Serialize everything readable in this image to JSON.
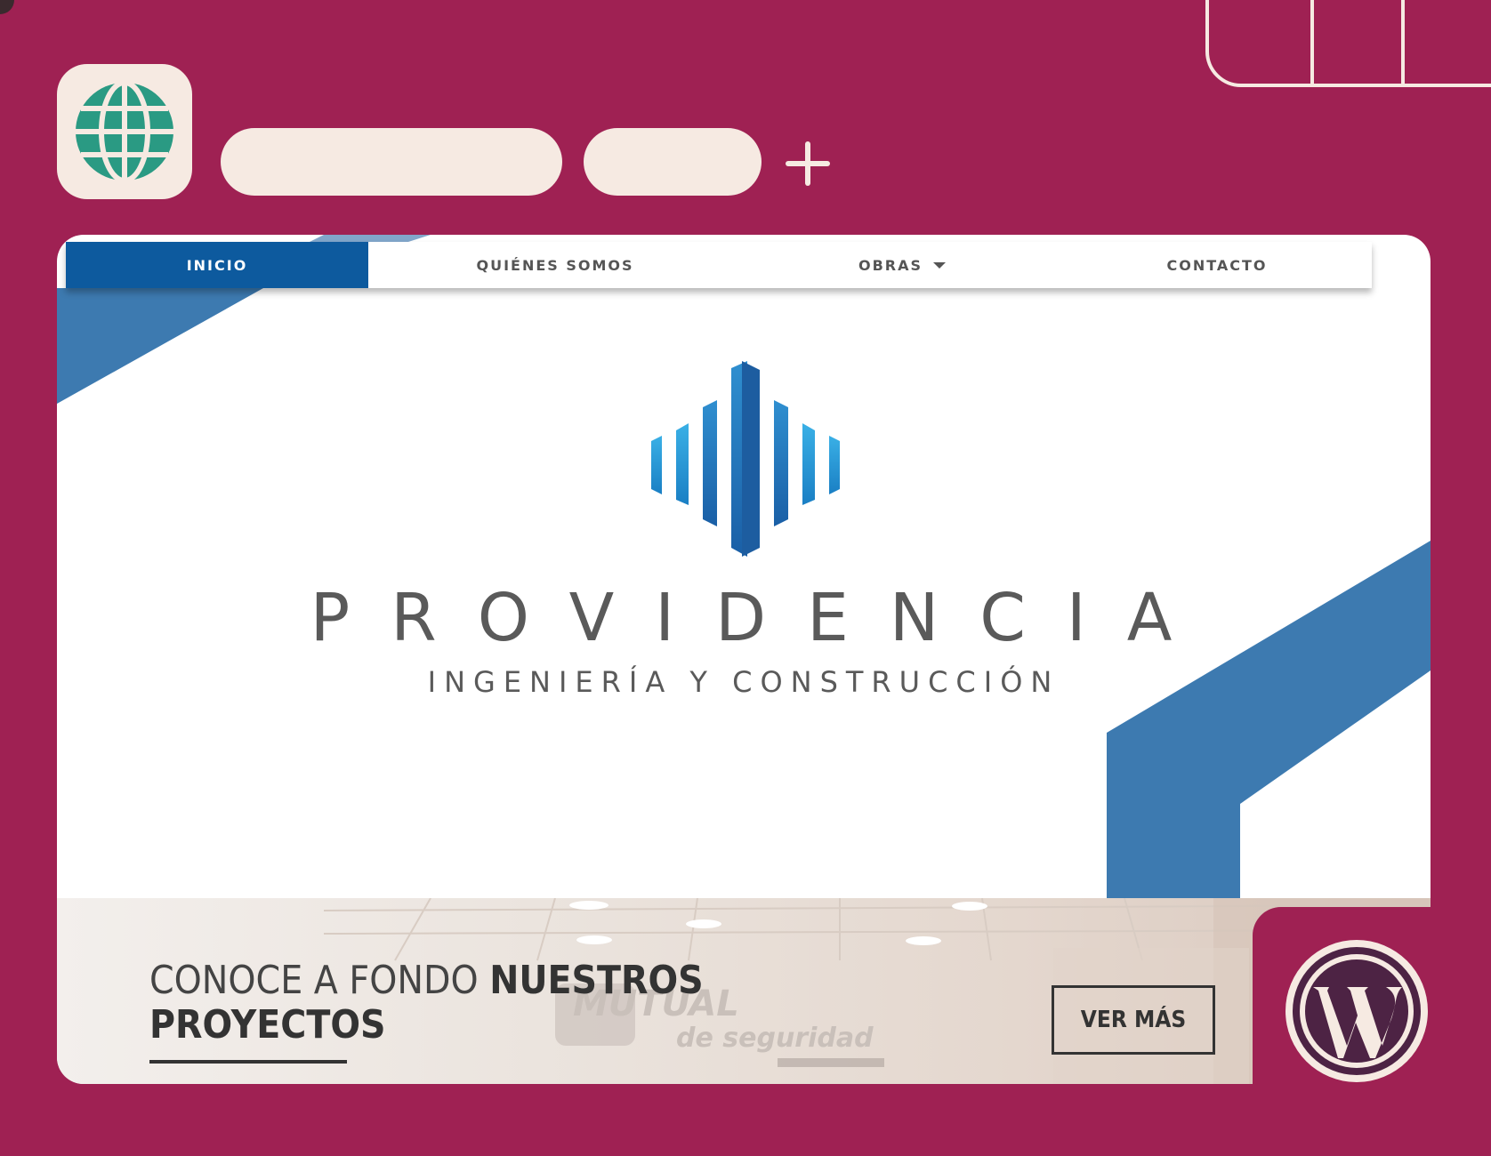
{
  "browser": {
    "tabs": [
      {
        "label": ""
      },
      {
        "label": ""
      }
    ],
    "new_tab_icon": "plus-icon",
    "favicon_icon": "globe-icon"
  },
  "site": {
    "nav": {
      "items": [
        {
          "label": "INICIO",
          "active": true
        },
        {
          "label": "QUIÉNES SOMOS",
          "active": false
        },
        {
          "label": "OBRAS",
          "active": false,
          "has_dropdown": true
        },
        {
          "label": "CONTACTO",
          "active": false
        }
      ]
    },
    "brand": {
      "name": "PROVIDENCIA",
      "subtitle": "INGENIERÍA Y CONSTRUCCIÓN"
    },
    "hero": {
      "title_light": "CONOCE A FONDO",
      "title_bold_1": "NUESTROS",
      "title_bold_2": "PROYECTOS",
      "cta_label": "VER MÁS",
      "watermark_line1": "MUTUAL",
      "watermark_line2": "de seguridad"
    }
  },
  "badge": {
    "icon": "wordpress-icon"
  },
  "colors": {
    "frame": "#9f2153",
    "cream": "#f6eae2",
    "nav_active": "#0d5a9e",
    "accent_blue": "#3d7ab0",
    "globe_teal": "#2a9a83"
  }
}
